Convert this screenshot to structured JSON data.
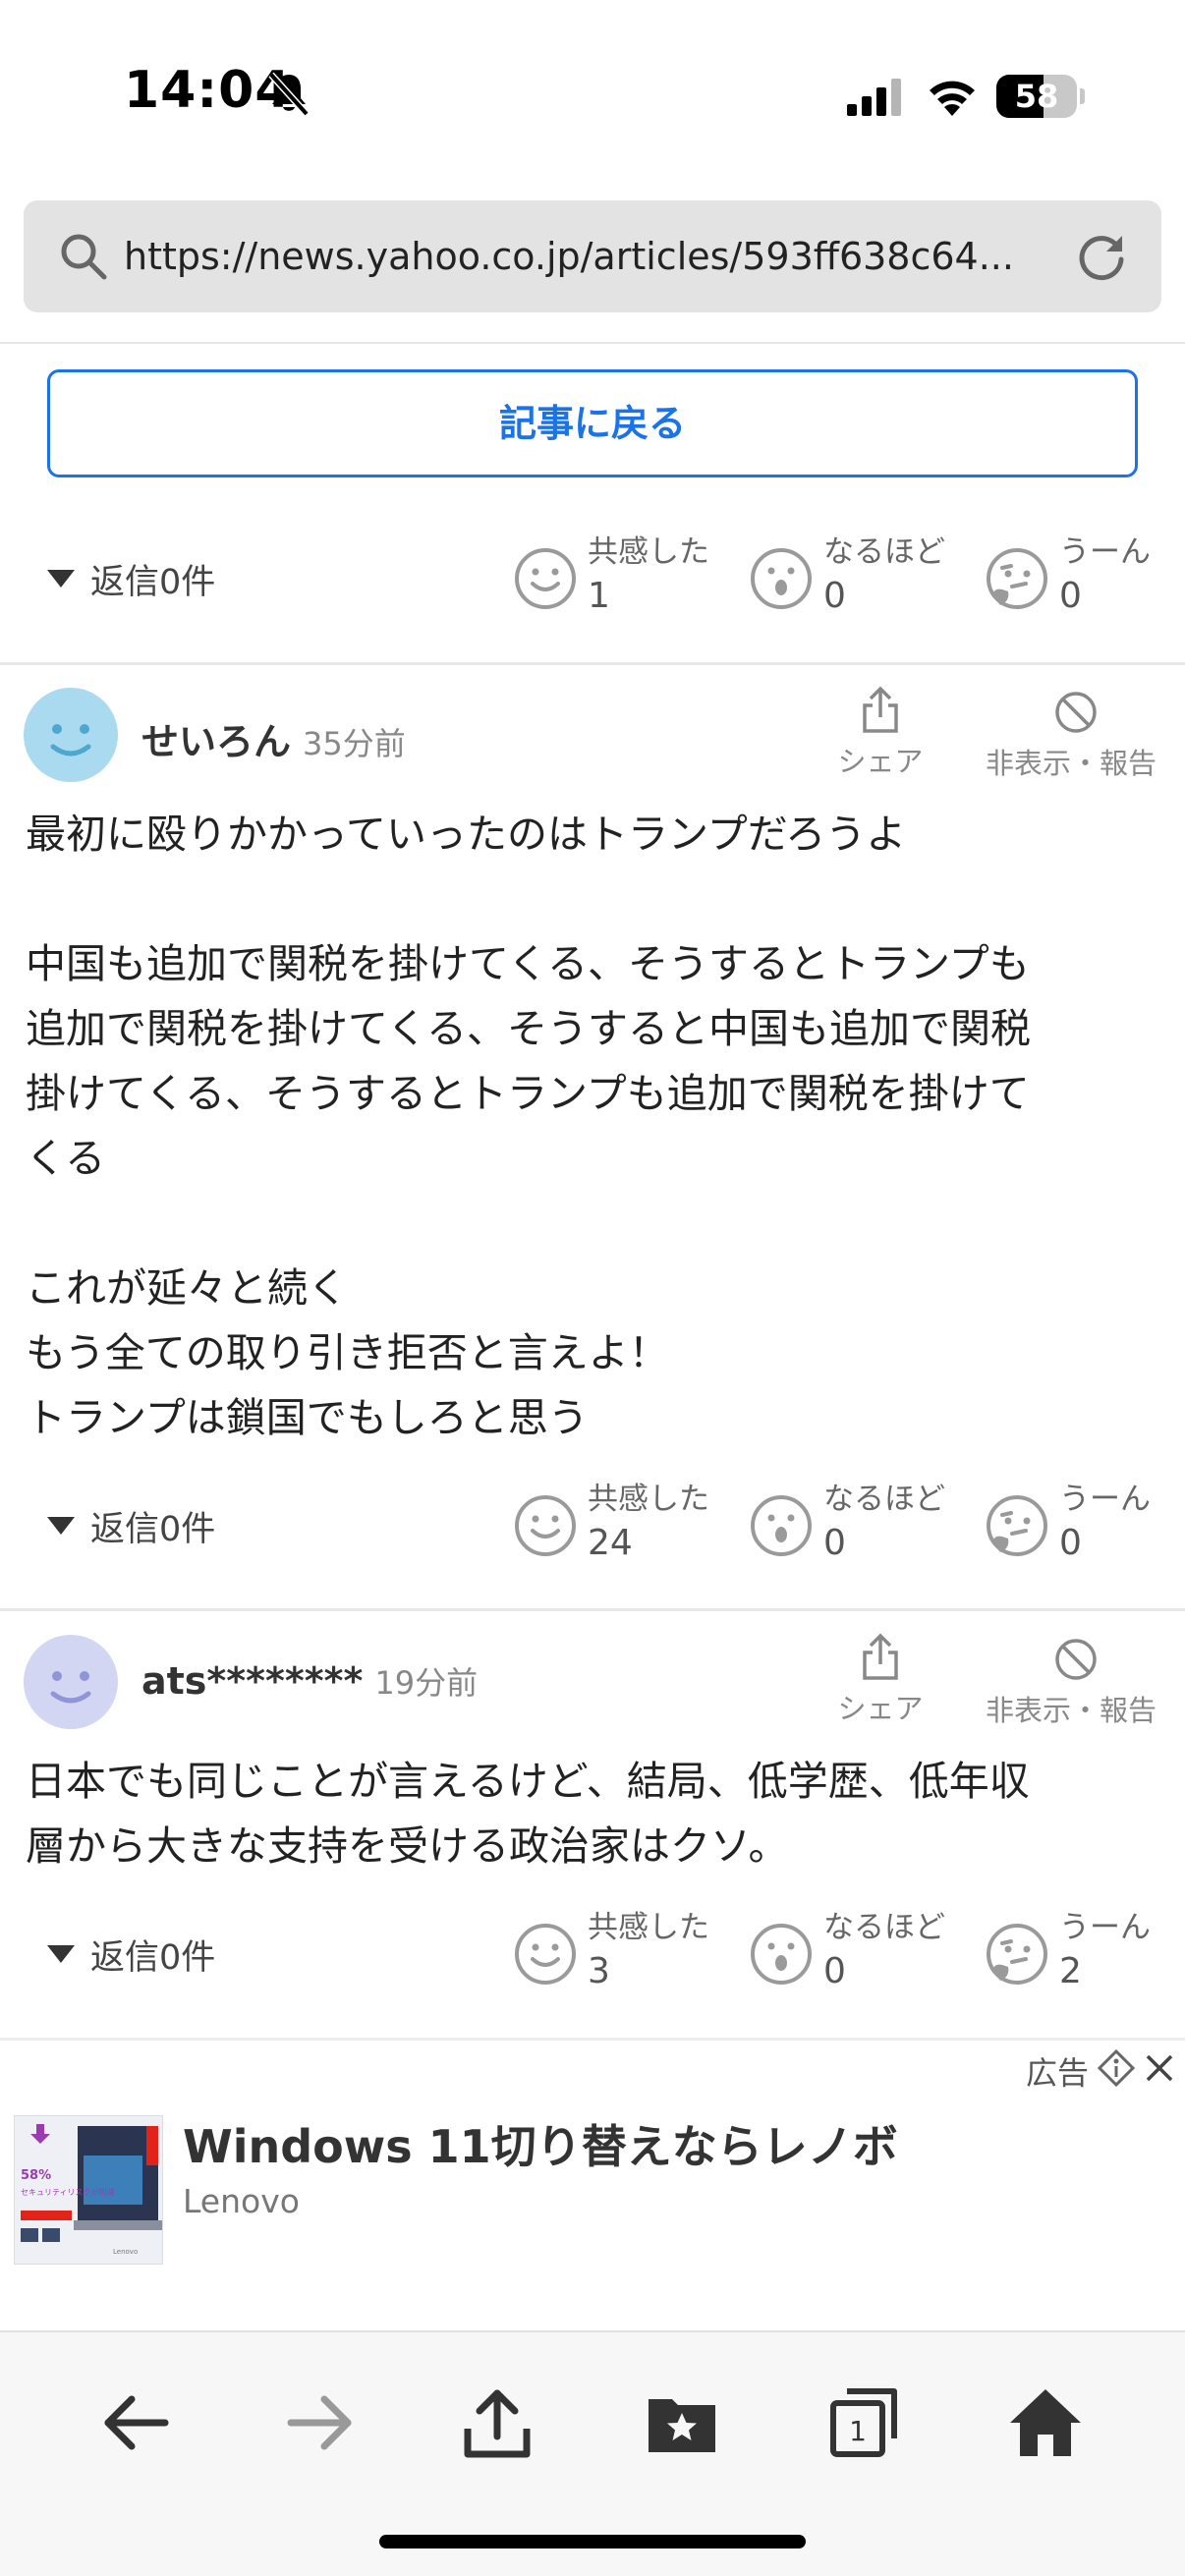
{
  "status_bar": {
    "time": "14:04",
    "battery": "58",
    "battery_level": 0.58
  },
  "browser": {
    "url": "https://news.yahoo.co.jp/articles/593ff638c64..."
  },
  "back_button_label": "記事に戻る",
  "reactions_labels": {
    "empathize": "共感した",
    "understand": "なるほど",
    "hmm": "うーん"
  },
  "reply_label": "返信",
  "top_reaction_row": {
    "replies": "0件",
    "empathize": "1",
    "understand": "0",
    "hmm": "0"
  },
  "comments": [
    {
      "user": "せいろん",
      "time": "35分前",
      "avatar_color": "#a9daf0",
      "share_label": "シェア",
      "hide_label": "非表示・報告",
      "body": "最初に殴りかかっていったのはトランプだろうよ\n\n中国も追加で関税を掛けてくる、そうするとトランプも\n追加で関税を掛けてくる、そうすると中国も追加で関税\n掛けてくる、そうするとトランプも追加で関税を掛けて\nくる\n\nこれが延々と続く\nもう全ての取り引き拒否と言えよ！\nトランプは鎖国でもしろと思う",
      "replies": "0件",
      "empathize": "24",
      "understand": "0",
      "hmm": "0"
    },
    {
      "user": "ats********",
      "time": "19分前",
      "avatar_color": "#d3d6f2",
      "share_label": "シェア",
      "hide_label": "非表示・報告",
      "body": "日本でも同じことが言えるけど、結局、低学歴、低年収\n層から大きな支持を受ける政治家はクソ。",
      "replies": "0件",
      "empathize": "3",
      "understand": "0",
      "hmm": "2"
    }
  ],
  "ad": {
    "label": "広告",
    "title": "Windows 11切り替えならレノボ",
    "sponsor": "Lenovo",
    "image_text_pct": "58%",
    "image_text_line": "セキュリティリスクが削減",
    "image_brand": "Lenovo"
  },
  "toolbar": {
    "items": [
      "back-arrow-icon",
      "forward-arrow-icon",
      "share-icon",
      "bookmarks-icon",
      "tabs-icon",
      "home-icon"
    ],
    "tab_count": "1"
  },
  "colors": {
    "accent": "#1a73e8",
    "reaction_gray": "#9a9a9a"
  }
}
